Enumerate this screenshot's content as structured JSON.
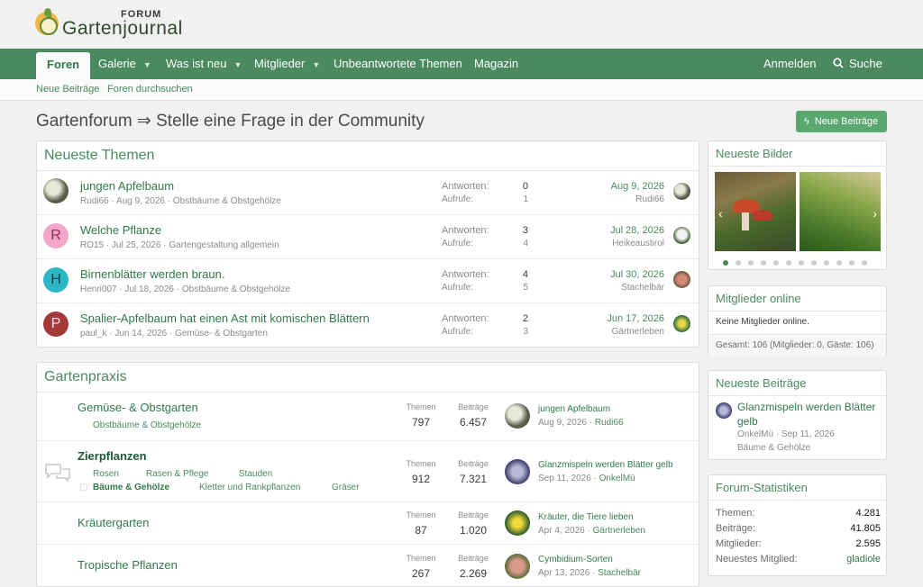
{
  "brand": {
    "forum": "FORUM",
    "name": "Gartenjournal"
  },
  "nav": {
    "items": [
      {
        "label": "Foren"
      },
      {
        "label": "Galerie"
      },
      {
        "label": "Was ist neu"
      },
      {
        "label": "Mitglieder"
      },
      {
        "label": "Unbeantwortete Themen"
      },
      {
        "label": "Magazin"
      }
    ],
    "login": "Anmelden",
    "search": "Suche"
  },
  "subnav": {
    "new_posts": "Neue Beiträge",
    "search_forums": "Foren durchsuchen"
  },
  "page": {
    "title": "Gartenforum ⇒ Stelle eine Frage in der Community",
    "new_posts_button": "Neue Beiträge"
  },
  "latest_threads": {
    "heading": "Neueste Themen",
    "replies_label": "Antworten:",
    "views_label": "Aufrufe:",
    "items": [
      {
        "title": "jungen Apfelbaum",
        "author": "Rudi66",
        "date": "Aug 9, 2026",
        "forum": "Obstbäume & Obstgehölze",
        "replies": "0",
        "views": "1",
        "last_date": "Aug 9, 2026",
        "last_user": "Rudi66",
        "avatar_letter": "",
        "avatar_color": "#6b6b55"
      },
      {
        "title": "Welche Pflanze",
        "author": "RO15",
        "date": "Jul 25, 2026",
        "forum": "Gartengestaltung allgemein",
        "replies": "3",
        "views": "4",
        "last_date": "Jul 28, 2026",
        "last_user": "Heikeaustirol",
        "avatar_letter": "R",
        "avatar_color": "#f2a6c8"
      },
      {
        "title": "Birnenblätter werden braun.",
        "author": "Henri007",
        "date": "Jul 18, 2026",
        "forum": "Obstbäume & Obstgehölze",
        "replies": "4",
        "views": "5",
        "last_date": "Jul 30, 2026",
        "last_user": "Stachelbär",
        "avatar_letter": "H",
        "avatar_color": "#2ab8c4"
      },
      {
        "title": "Spalier-Apfelbaum hat einen Ast mit komischen Blättern",
        "author": "paul_k",
        "date": "Jun 14, 2026",
        "forum": "Gemüse- & Obstgarten",
        "replies": "2",
        "views": "3",
        "last_date": "Jun 17, 2026",
        "last_user": "Gärtnerleben",
        "avatar_letter": "P",
        "avatar_color": "#a33a3a"
      }
    ]
  },
  "gartenpraxis": {
    "heading": "Gartenpraxis",
    "themen_label": "Themen",
    "beitraege_label": "Beiträge",
    "forums": [
      {
        "title": "Gemüse- & Obstgarten",
        "subs": [
          "Obstbäume & Obstgehölze"
        ],
        "themen": "797",
        "beitraege": "6.457",
        "last_title": "jungen Apfelbaum",
        "last_date": "Aug 9, 2026",
        "last_user": "Rudi66"
      },
      {
        "title": "Zierpflanzen",
        "subs": [
          "Rosen",
          "Rasen & Pflege",
          "Stauden",
          "Bäume & Gehölze",
          "Kletter und Rankpflanzen",
          "Gräser"
        ],
        "themen": "912",
        "beitraege": "7.321",
        "last_title": "Glanzmispeln werden Blätter gelb",
        "last_date": "Sep 11, 2026",
        "last_user": "OnkelMü"
      },
      {
        "title": "Kräutergarten",
        "subs": [],
        "themen": "87",
        "beitraege": "1.020",
        "last_title": "Kräuter, die Tiere lieben",
        "last_date": "Apr 4, 2026",
        "last_user": "Gärtnerleben"
      },
      {
        "title": "Tropische Pflanzen",
        "subs": [],
        "themen": "267",
        "beitraege": "2.269",
        "last_title": "Cymbidium-Sorten",
        "last_date": "Apr 13, 2026",
        "last_user": "Stachelbär"
      }
    ]
  },
  "sidebar": {
    "images": {
      "heading": "Neueste Bilder"
    },
    "online": {
      "heading": "Mitglieder online",
      "text": "Keine Mitglieder online.",
      "total": "Gesamt: 106 (Mitglieder: 0, Gäste: 106)"
    },
    "latest_posts": {
      "heading": "Neueste Beiträge",
      "title": "Glanzmispeln werden Blätter gelb",
      "user": "OnkelMü",
      "date": "Sep 11, 2026",
      "forum": "Bäume & Gehölze"
    },
    "stats": {
      "heading": "Forum-Statistiken",
      "rows": [
        {
          "label": "Themen:",
          "value": "4.281"
        },
        {
          "label": "Beiträge:",
          "value": "41.805"
        },
        {
          "label": "Mitglieder:",
          "value": "2.595"
        },
        {
          "label": "Neuestes Mitglied:",
          "value": "gladiole"
        }
      ]
    }
  },
  "colors": {
    "accent": "#4a8a5e",
    "link": "#2f7a4a",
    "button": "#5aa870"
  }
}
